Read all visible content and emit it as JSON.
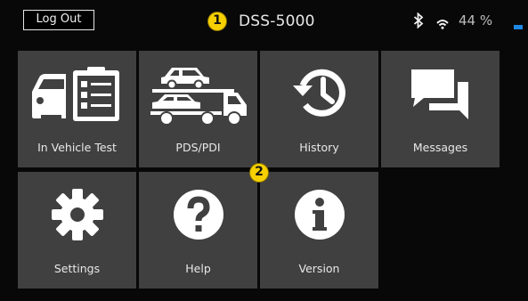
{
  "header": {
    "logout_label": "Log Out",
    "device_name": "DSS-5000",
    "battery_percent_text": "44 %",
    "icons": [
      "bluetooth-icon",
      "wifi-icon",
      "battery-icon"
    ]
  },
  "callouts": [
    "1",
    "2"
  ],
  "tiles": [
    {
      "label": "In Vehicle Test",
      "icon": "vehicle-test-icon"
    },
    {
      "label": "PDS/PDI",
      "icon": "car-carrier-truck-icon"
    },
    {
      "label": "History",
      "icon": "history-icon"
    },
    {
      "label": "Messages",
      "icon": "messages-icon"
    },
    {
      "label": "Settings",
      "icon": "gear-icon"
    },
    {
      "label": "Help",
      "icon": "help-icon"
    },
    {
      "label": "Version",
      "icon": "info-icon"
    }
  ],
  "colors": {
    "background": "#080808",
    "tile": "#404040",
    "callout": "#f6d000",
    "battery": "#1e88e5",
    "text": "#e8e8e8"
  }
}
